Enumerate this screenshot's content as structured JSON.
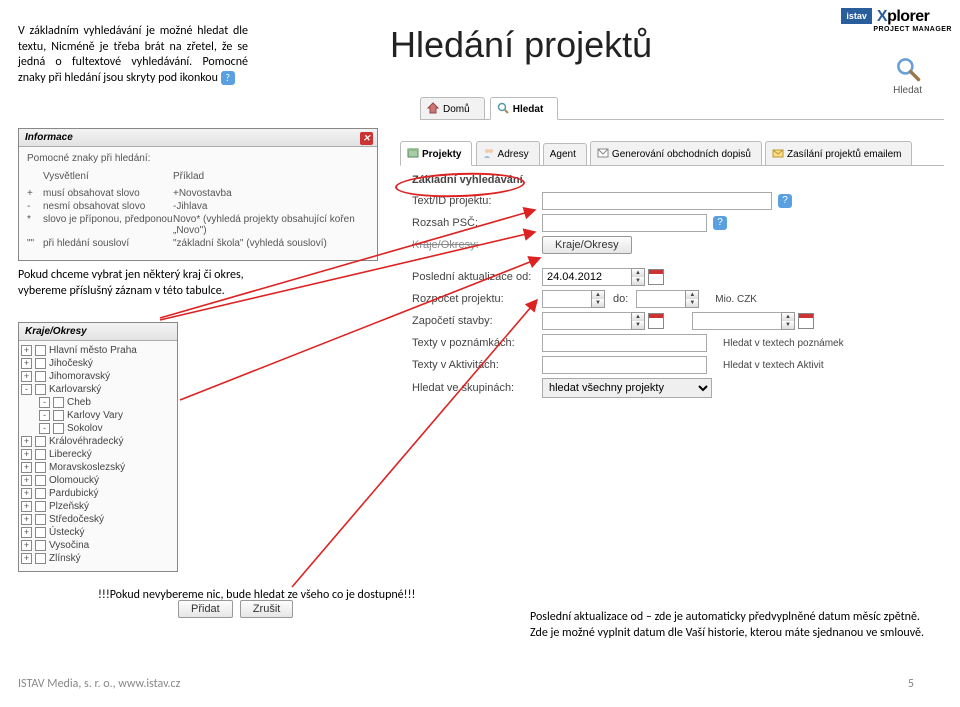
{
  "page_title": "Hledání projektů",
  "logo": {
    "brand": "istav",
    "product": "Xplorer",
    "sub": "PROJECT MANAGER"
  },
  "search_widget": {
    "label": "Hledat"
  },
  "doc_para1": "V základním vyhledávání je možné hledat dle textu, Nicméně je třeba brát na zřetel, že se jedná o fultextové vyhledávání. Pomocné znaky při hledání jsou skryty pod ikonkou",
  "doc_para2": "Pokud chceme vybrat jen některý kraj či okres, vybereme příslušný záznam v této tabulce.",
  "doc_warn": "!!!Pokud nevybereme nic, bude hledat ze všeho co je dostupné!!!",
  "doc_bottom": "Poslední aktualizace od – zde je automaticky předvyplněné datum měsíc zpětně. Zde je možné vyplnit datum dle Vaší historie, kterou máte sjednanou ve smlouvě.",
  "footer": "ISTAV Media, s. r. o., www.istav.cz",
  "page_number": "5",
  "nav_tabs": {
    "domu": "Domů",
    "hledat": "Hledat"
  },
  "info_panel": {
    "title": "Informace",
    "subtitle": "Pomocné znaky při hledání:",
    "col1": "Vysvětlení",
    "col2": "Příklad",
    "rows": [
      {
        "s": "+",
        "t": "musí obsahovat slovo",
        "e": "+Novostavba"
      },
      {
        "s": "-",
        "t": "nesmí obsahovat slovo",
        "e": "-Jihlava"
      },
      {
        "s": "*",
        "t": "slovo je příponou, předponou",
        "e": "Novo* (vyhledá projekty obsahující kořen „Novo\")"
      },
      {
        "s": "\"\"",
        "t": "při hledání sousloví",
        "e": "\"základní škola\" (vyhledá sousloví)"
      }
    ]
  },
  "inner_tabs": {
    "projekty": "Projekty",
    "adresy": "Adresy",
    "agent": "Agent",
    "generovani": "Generování obchodních dopisů",
    "zasilani": "Zasílání projektů emailem"
  },
  "section_title": "Základní vyhledávání",
  "form": {
    "text_id": {
      "label": "Text/ID projektu:",
      "value": ""
    },
    "rozsah": {
      "label": "Rozsah PSČ:",
      "value": ""
    },
    "kraje_okresy_lbl": "Kraje/Okresy:",
    "kraje_btn": "Kraje/Okresy",
    "posledni": {
      "label": "Poslední aktualizace od:",
      "value": "24.04.2012"
    },
    "rozpocet": {
      "label": "Rozpočet projektu:",
      "do": "do:",
      "unit": "Mio. CZK"
    },
    "zapoceti": {
      "label": "Započetí stavby:"
    },
    "texty_pozn": {
      "label": "Texty v poznámkách:",
      "note": "Hledat v textech poznámek"
    },
    "texty_akt": {
      "label": "Texty v Aktivitách:",
      "note": "Hledat v textech Aktivit"
    },
    "skupiny": {
      "label": "Hledat ve skupinách:",
      "value": "hledat všechny projekty"
    }
  },
  "tree": {
    "title": "Kraje/Okresy",
    "items": [
      {
        "pm": "+",
        "name": "Hlavní město Praha"
      },
      {
        "pm": "+",
        "name": "Jihočeský"
      },
      {
        "pm": "+",
        "name": "Jihomoravský"
      },
      {
        "pm": "-",
        "name": "Karlovarský",
        "children": [
          {
            "pm": "-",
            "name": "Cheb"
          },
          {
            "pm": "-",
            "name": "Karlovy Vary"
          },
          {
            "pm": "-",
            "name": "Sokolov"
          }
        ]
      },
      {
        "pm": "+",
        "name": "Královéhradecký"
      },
      {
        "pm": "+",
        "name": "Liberecký"
      },
      {
        "pm": "+",
        "name": "Moravskoslezský"
      },
      {
        "pm": "+",
        "name": "Olomoucký"
      },
      {
        "pm": "+",
        "name": "Pardubický"
      },
      {
        "pm": "+",
        "name": "Plzeňský"
      },
      {
        "pm": "+",
        "name": "Středočeský"
      },
      {
        "pm": "+",
        "name": "Ústecký"
      },
      {
        "pm": "+",
        "name": "Vysočina"
      },
      {
        "pm": "+",
        "name": "Zlínský"
      }
    ]
  },
  "btns": {
    "pridat": "Přidat",
    "zrusit": "Zrušit"
  }
}
